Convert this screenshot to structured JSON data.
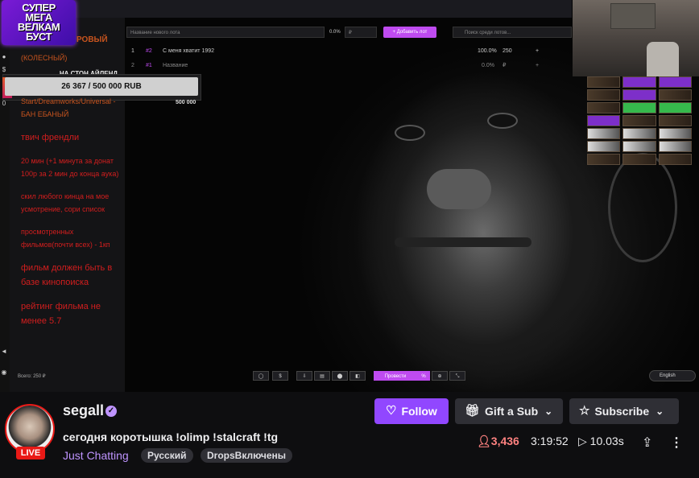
{
  "overlay": {
    "logo_lines": [
      "СУПЕР",
      "МЕГА",
      "ВЕЛКАМ",
      "БУСТ"
    ],
    "header_fragment": "РОВЫЙ",
    "wheel_label": "(КОЛЕСНЫЙ)",
    "island_label": "НА СТОН АЙЛЕНД",
    "donation_progress_text": "26 367 / 500 000 RUB",
    "donation_progress_fraction": 0.0527,
    "total_label": "500 000",
    "rules": [
      "Start/Dreamworks/Universal - БАН ЕБАНЫЙ",
      "твич френдли",
      "20 мин (+1 минута за донат 100р за 2 мин до конца аука)",
      "скил любого кинца на мое усмотрение, сори список",
      "просмотренных фильмов(почти всех) - 1кп",
      "фильм должен быть в базе кинопоиска",
      "рейтинг фильма не менее 5.7"
    ],
    "lot_input_placeholder": "Название нового лота",
    "lot_percent": "0.0%",
    "lot_amount_placeholder": "₽",
    "add_lot_button": "+ Добавить лот",
    "search_placeholder": "Поиск среди лотов...",
    "lots": [
      {
        "num": "1",
        "id": "#2",
        "name": "С меня хватит 1992",
        "percent": "100.0%",
        "amount": "250"
      },
      {
        "num": "2",
        "id": "#1",
        "name": "Название",
        "percent": "0.0%",
        "amount": "₽"
      }
    ],
    "sum_text": "Всего: 250 ₽",
    "tools": [
      "◯",
      "$",
      "⇩",
      "▤",
      "⬤",
      "◧",
      "Провести",
      "%",
      "⊕",
      "⤡"
    ],
    "language": "English",
    "side_icons": [
      "●",
      "$",
      "0",
      "◄",
      "◉"
    ]
  },
  "channel": {
    "name": "segall",
    "live_label": "LIVE",
    "title": "сегодня коротышка !olimp !stalcraft !tg",
    "category": "Just Chatting",
    "tags": [
      "Русский",
      "DropsВключены"
    ]
  },
  "actions": {
    "follow_label": "Follow",
    "gift_label": "Gift a Sub",
    "subscribe_label": "Subscribe"
  },
  "stats": {
    "viewers": "3,436",
    "uptime": "3:19:52",
    "delay": "10.03s"
  },
  "colors": {
    "accent": "#9147ff",
    "live": "#e91916",
    "viewer_count": "#ff8280",
    "category": "#bf94ff"
  }
}
